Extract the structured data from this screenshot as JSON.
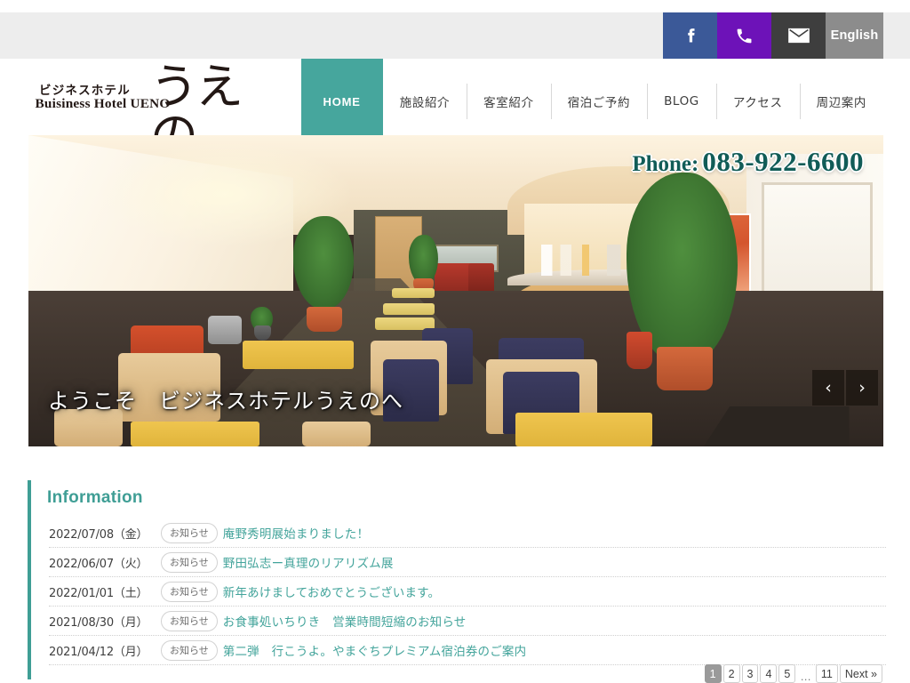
{
  "topbar": {
    "items": [
      {
        "name": "facebook",
        "icon": "facebook-icon",
        "label": "",
        "color": "#3b5998"
      },
      {
        "name": "phone",
        "icon": "phone-icon",
        "label": "",
        "color": "#6d12b8"
      },
      {
        "name": "mail",
        "icon": "mail-icon",
        "label": "",
        "color": "#3e3e3e"
      },
      {
        "name": "language",
        "icon": "",
        "label": "English",
        "color": "#8c8c8c"
      }
    ]
  },
  "logo": {
    "kana": "ビジネスホテル",
    "roman": "Buisiness Hotel UENO",
    "brush": "うえの"
  },
  "nav": {
    "items": [
      {
        "label": "HOME",
        "active": true
      },
      {
        "label": "施設紹介",
        "active": false
      },
      {
        "label": "客室紹介",
        "active": false
      },
      {
        "label": "宿泊ご予約",
        "active": false
      },
      {
        "label": "BLOG",
        "active": false
      },
      {
        "label": "アクセス",
        "active": false
      },
      {
        "label": "周辺案内",
        "active": false
      }
    ],
    "accent_color": "#46a69d"
  },
  "hero": {
    "phone_label": "Phone:",
    "phone_number": "083-922-6600",
    "phone_color": "#115c57",
    "caption": "ようこそ　ビジネスホテルうえのへ",
    "prev_arrow": "‹",
    "next_arrow": "›"
  },
  "information": {
    "title": "Information",
    "accent_color": "#3f9e95",
    "items": [
      {
        "date": "2022/07/08（金）",
        "badge": "お知らせ",
        "title": "庵野秀明展始まりました！"
      },
      {
        "date": "2022/06/07（火）",
        "badge": "お知らせ",
        "title": "野田弘志ー真理のリアリズム展"
      },
      {
        "date": "2022/01/01（土）",
        "badge": "お知らせ",
        "title": "新年あけましておめでとうございます。"
      },
      {
        "date": "2021/08/30（月）",
        "badge": "お知らせ",
        "title": "お食事処いちりき　営業時間短縮のお知らせ"
      },
      {
        "date": "2021/04/12（月）",
        "badge": "お知らせ",
        "title": "第二弾　行こうよ。やまぐちプレミアム宿泊券のご案内"
      }
    ]
  },
  "pagination": {
    "pages": [
      "1",
      "2",
      "3",
      "4",
      "5"
    ],
    "current": "1",
    "ellipsis": "…",
    "last": "11",
    "next": "Next »"
  }
}
